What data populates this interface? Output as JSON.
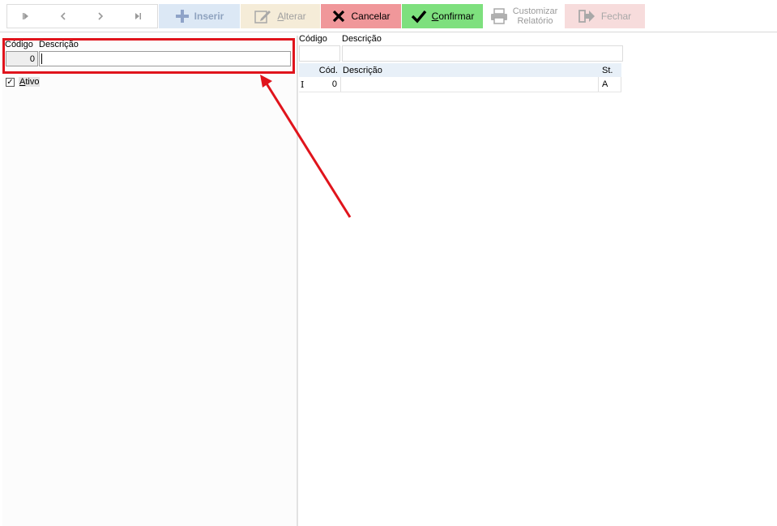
{
  "toolbar": {
    "inserir": "Inserir",
    "alterar": "Alterar",
    "cancelar": "Cancelar",
    "confirmar": "Confirmar",
    "relatorio_line1": "Customizar",
    "relatorio_line2": "Relatório",
    "fechar": "Fechar",
    "icons": {
      "first": "first-record-icon",
      "prev": "prev-record-icon",
      "next": "next-record-icon",
      "last": "last-record-icon",
      "inserir": "plus-icon",
      "alterar": "edit-icon",
      "cancelar": "x-icon",
      "confirmar": "check-icon",
      "relatorio": "printer-icon",
      "fechar": "exit-icon"
    },
    "colors": {
      "inserir_bg": "#dce8f5",
      "alterar_bg": "#f5ecd8",
      "cancelar_bg": "#f0979a",
      "confirmar_bg": "#7ee07e",
      "fechar_bg": "#f7dcdc"
    }
  },
  "form": {
    "codigo_label": "Código",
    "descricao_label": "Descrição",
    "codigo_value": "0",
    "descricao_value": "",
    "ativo_label": "Ativo",
    "ativo_checked": true
  },
  "filter": {
    "codigo_label": "Código",
    "descricao_label": "Descrição",
    "codigo_value": "",
    "descricao_value": ""
  },
  "grid": {
    "columns": [
      "Cód.",
      "Descrição",
      "St."
    ],
    "rows": [
      {
        "indicator": "I",
        "cod": "0",
        "descricao": "",
        "st": "A"
      }
    ]
  },
  "annotation": {
    "highlight_color": "#e0141c"
  }
}
